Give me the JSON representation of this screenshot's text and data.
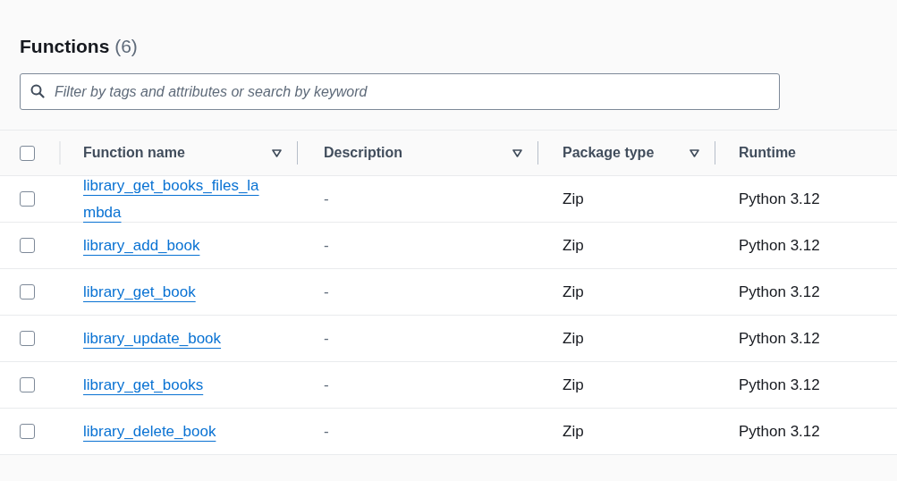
{
  "header": {
    "title": "Functions",
    "count": "(6)"
  },
  "search": {
    "placeholder": "Filter by tags and attributes or search by keyword"
  },
  "table": {
    "select_all": {
      "checked": false
    },
    "columns": [
      {
        "label": "Function name",
        "filter": true
      },
      {
        "label": "Description",
        "filter": true
      },
      {
        "label": "Package type",
        "filter": true
      },
      {
        "label": "Runtime",
        "filter": false
      }
    ],
    "rows": [
      {
        "checked": false,
        "name": "library_get_books_files_lambda",
        "description": "-",
        "package_type": "Zip",
        "runtime": "Python 3.12"
      },
      {
        "checked": false,
        "name": "library_add_book",
        "description": "-",
        "package_type": "Zip",
        "runtime": "Python 3.12"
      },
      {
        "checked": false,
        "name": "library_get_book",
        "description": "-",
        "package_type": "Zip",
        "runtime": "Python 3.12"
      },
      {
        "checked": false,
        "name": "library_update_book",
        "description": "-",
        "package_type": "Zip",
        "runtime": "Python 3.12"
      },
      {
        "checked": false,
        "name": "library_get_books",
        "description": "-",
        "package_type": "Zip",
        "runtime": "Python 3.12"
      },
      {
        "checked": false,
        "name": "library_delete_book",
        "description": "-",
        "package_type": "Zip",
        "runtime": "Python 3.12"
      }
    ]
  }
}
